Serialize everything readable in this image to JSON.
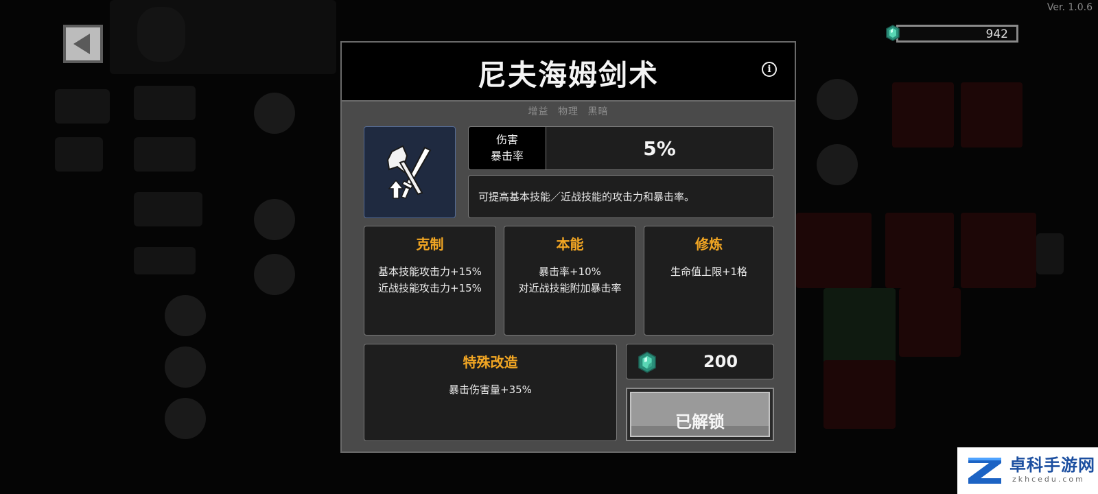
{
  "version": "Ver. 1.0.6",
  "currency": {
    "amount": "942",
    "icon": "emerald-gem-icon",
    "color": "#3bbf9a"
  },
  "modal": {
    "title": "尼夫海姆剑术",
    "tags": [
      "增益",
      "物理",
      "黑暗"
    ],
    "skill_icon": "axe-sword-up-arrow-icon",
    "stat": {
      "label_line1": "伤害",
      "label_line2": "暴击率",
      "value": "5%"
    },
    "description": "可提高基本技能／近战技能的攻击力和暴击率。",
    "panels": {
      "counter": {
        "title": "克制",
        "lines": [
          "基本技能攻击力+15%",
          "近战技能攻击力+15%"
        ]
      },
      "instinct": {
        "title": "本能",
        "lines": [
          "暴击率+10%",
          "对近战技能附加暴击率"
        ]
      },
      "training": {
        "title": "修炼",
        "lines": [
          "生命值上限+1格"
        ]
      },
      "special": {
        "title": "特殊改造",
        "lines": [
          "暴击伤害量+35%"
        ]
      }
    },
    "cost": {
      "amount": "200",
      "icon": "emerald-gem-icon"
    },
    "unlock_button_label": "已解锁",
    "accent_color": "#f2a623"
  },
  "watermark": {
    "text": "卓科手游网",
    "sub": "zkhcedu.com"
  }
}
